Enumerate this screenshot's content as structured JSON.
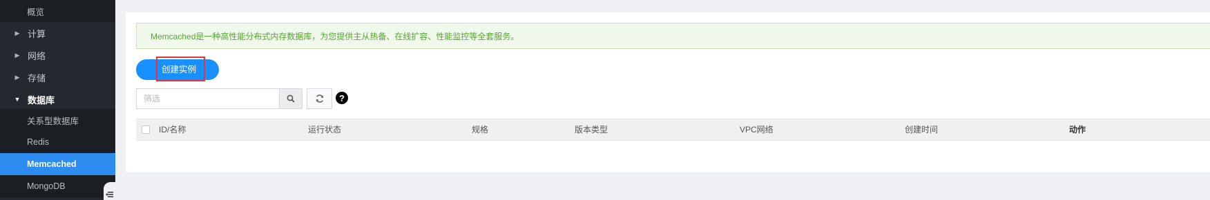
{
  "sidebar": {
    "items": [
      {
        "type": "sub",
        "label": "概览"
      },
      {
        "type": "group",
        "label": "计算",
        "arrow": "▶"
      },
      {
        "type": "group",
        "label": "网络",
        "arrow": "▶"
      },
      {
        "type": "group",
        "label": "存储",
        "arrow": "▶"
      },
      {
        "type": "group-open",
        "label": "数据库",
        "arrow": "▼"
      },
      {
        "type": "sub",
        "label": "关系型数据库"
      },
      {
        "type": "sub",
        "label": "Redis"
      },
      {
        "type": "sub-active",
        "label": "Memcached"
      },
      {
        "type": "sub",
        "label": "MongoDB"
      }
    ],
    "collapse_icon": "collapse-menu-icon"
  },
  "notice": {
    "text": "Memcached是一种高性能分布式内存数据库，为您提供主从热备、在线扩容、性能监控等全套服务。",
    "color": "#52a829"
  },
  "toolbar": {
    "create_label": "创建实例",
    "filter_placeholder": "筛选",
    "search_icon": "search-icon",
    "refresh_icon": "refresh-icon",
    "help_label": "?"
  },
  "table": {
    "columns": [
      "ID/名称",
      "运行状态",
      "规格",
      "版本类型",
      "VPC网络",
      "创建时间",
      "动作"
    ]
  },
  "colors": {
    "accent": "#1890ff",
    "sidebar_bg": "#24282f",
    "sidebar_active": "#2d8cf0",
    "highlight_border": "#e8333a"
  }
}
